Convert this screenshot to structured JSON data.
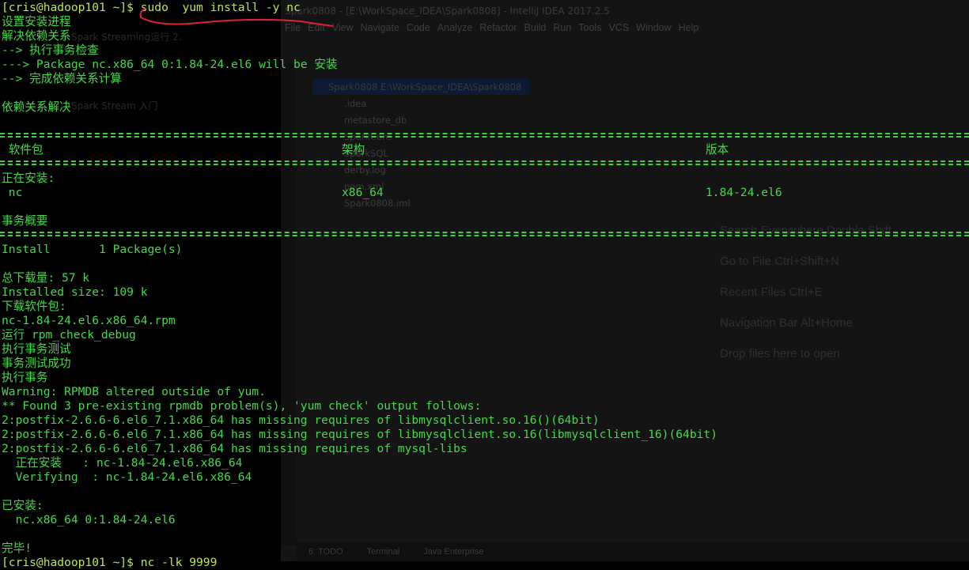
{
  "ide": {
    "title": "Spark0808 - [E:\\WorkSpace_IDEA\\Spark0808] - IntelliJ IDEA 2017.2.5",
    "menu": [
      "File",
      "Edit",
      "View",
      "Navigate",
      "Code",
      "Analyze",
      "Refactor",
      "Build",
      "Run",
      "Tools",
      "VCS",
      "Window",
      "Help"
    ],
    "project_root": "Spark0808  E:\\WorkSpace_IDEA\\Spark0808",
    "tree": [
      ".idea",
      "metastore_db",
      "SparkCore",
      "SparkSQL",
      "derby.log",
      "pom.xml",
      "Spark0808.iml"
    ],
    "hints": [
      "Search Everywhere Double Shift",
      "Go to File Ctrl+Shift+N",
      "Recent Files Ctrl+E",
      "Navigation Bar Alt+Home",
      "Drop files here to open"
    ],
    "bottom_tabs": [
      "6: TODO",
      "Terminal",
      "Java Enterprise"
    ],
    "left_ghost": [
      "Spark Streaming运行 2.",
      "Spark Stream 入门"
    ]
  },
  "terminal": {
    "prompt": "[cris@hadoop101 ~]$ ",
    "command": "sudo  yum install -y nc",
    "lines": [
      "设置安装进程",
      "解决依赖关系",
      "--> 执行事务检查",
      "---> Package nc.x86_64 0:1.84-24.el6 will be 安装",
      "--> 完成依赖关系计算",
      "",
      "依赖关系解决"
    ],
    "table_headers": [
      " 软件包",
      "架构",
      "版本"
    ],
    "installing_label": "正在安装:",
    "pkg_row": [
      " nc",
      "x86_64",
      "1.84-24.el6"
    ],
    "summary_label": "事务概要",
    "tail": [
      "Install       1 Package(s)",
      "",
      "总下载量: 57 k",
      "Installed size: 109 k",
      "下载软件包:",
      "nc-1.84-24.el6.x86_64.rpm",
      "运行 rpm_check_debug",
      "执行事务测试",
      "事务测试成功",
      "执行事务",
      "Warning: RPMDB altered outside of yum.",
      "** Found 3 pre-existing rpmdb problem(s), 'yum check' output follows:",
      "2:postfix-2.6.6-6.el6_7.1.x86_64 has missing requires of libmysqlclient.so.16()(64bit)",
      "2:postfix-2.6.6-6.el6_7.1.x86_64 has missing requires of libmysqlclient.so.16(libmysqlclient_16)(64bit)",
      "2:postfix-2.6.6-6.el6_7.1.x86_64 has missing requires of mysql-libs",
      "  正在安装   : nc-1.84-24.el6.x86_64",
      "  Verifying  : nc-1.84-24.el6.x86_64",
      "",
      "已安装:",
      "  nc.x86_64 0:1.84-24.el6",
      "",
      "完毕!",
      "[cris@hadoop101 ~]$ nc -lk 9999"
    ]
  },
  "colors": {
    "terminal_green": "#46d84a",
    "annotation_red": "#e0203a"
  }
}
